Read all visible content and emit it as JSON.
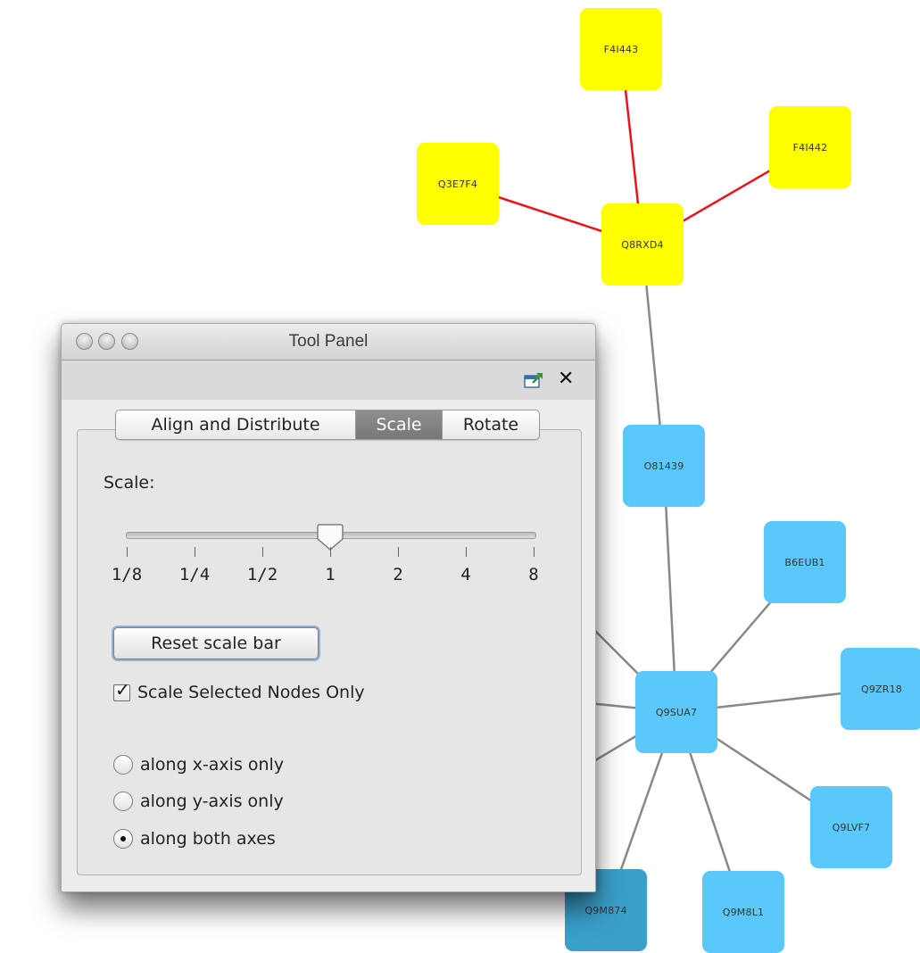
{
  "graph": {
    "nodes": [
      {
        "id": "F4I443",
        "label": "F4I443",
        "color": "yellow"
      },
      {
        "id": "F4I442",
        "label": "F4I442",
        "color": "yellow"
      },
      {
        "id": "Q3E7F4",
        "label": "Q3E7F4",
        "color": "yellow"
      },
      {
        "id": "Q8RXD4",
        "label": "Q8RXD4",
        "color": "yellow"
      },
      {
        "id": "O81439",
        "label": "O81439",
        "color": "blue"
      },
      {
        "id": "B6EUB1",
        "label": "B6EUB1",
        "color": "blue"
      },
      {
        "id": "Q9SUA7",
        "label": "Q9SUA7",
        "color": "blue"
      },
      {
        "id": "Q9ZR18",
        "label": "Q9ZR18",
        "color": "blue"
      },
      {
        "id": "Q9LVF7",
        "label": "Q9LVF7",
        "color": "blue"
      },
      {
        "id": "Q9M8L1",
        "label": "Q9M8L1",
        "color": "blue"
      },
      {
        "id": "Q9M874",
        "label": "Q9M874",
        "color": "blue"
      }
    ],
    "edges": [
      {
        "from": "Q8RXD4",
        "to": "F4I443",
        "color": "red"
      },
      {
        "from": "Q8RXD4",
        "to": "F4I442",
        "color": "red"
      },
      {
        "from": "Q8RXD4",
        "to": "Q3E7F4",
        "color": "red"
      },
      {
        "from": "Q8RXD4",
        "to": "O81439",
        "color": "gray"
      },
      {
        "from": "O81439",
        "to": "Q9SUA7",
        "color": "gray"
      },
      {
        "from": "Q9SUA7",
        "to": "B6EUB1",
        "color": "gray"
      },
      {
        "from": "Q9SUA7",
        "to": "Q9ZR18",
        "color": "gray"
      },
      {
        "from": "Q9SUA7",
        "to": "Q9LVF7",
        "color": "gray"
      },
      {
        "from": "Q9SUA7",
        "to": "Q9M8L1",
        "color": "gray"
      },
      {
        "from": "Q9SUA7",
        "to": "Q9M874",
        "color": "gray"
      }
    ],
    "colors": {
      "yellow": "#ffff00",
      "blue": "#5ac8fa",
      "red": "#e8141a",
      "gray": "#888888"
    }
  },
  "window": {
    "title": "Tool Panel",
    "dock_icon": "dock-out-icon",
    "close_icon": "close-icon",
    "close_glyph": "✕",
    "tabs": [
      {
        "label": "Align and Distribute",
        "active": false
      },
      {
        "label": "Scale",
        "active": true
      },
      {
        "label": "Rotate",
        "active": false
      }
    ],
    "scale": {
      "label": "Scale:",
      "ticks": [
        "1/8",
        "1/4",
        "1/2",
        "1",
        "2",
        "4",
        "8"
      ],
      "selected": "1",
      "reset_button": "Reset scale bar",
      "checkbox_label": "Scale Selected Nodes Only",
      "checkbox_checked": true,
      "radios": [
        {
          "label": "along x-axis only",
          "selected": false
        },
        {
          "label": "along y-axis only",
          "selected": false
        },
        {
          "label": "along both axes",
          "selected": true
        }
      ]
    }
  }
}
